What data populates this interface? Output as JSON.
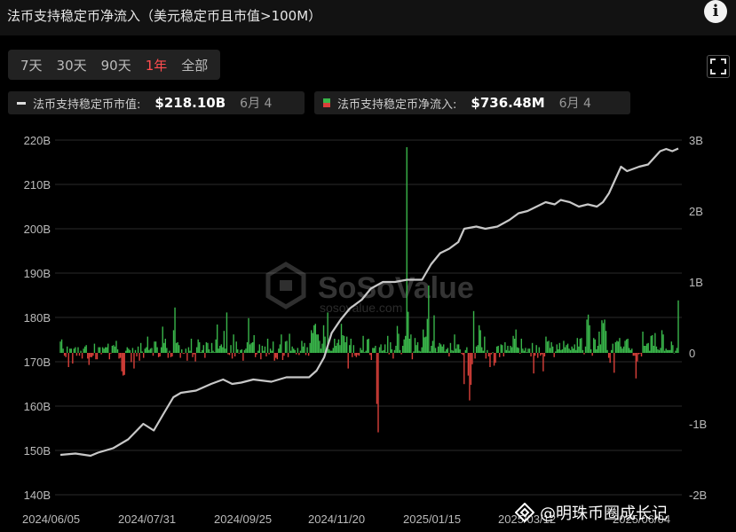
{
  "title": "法币支持稳定币净流入（美元稳定币且市值>100M）",
  "info_icon": "info-icon",
  "range_tabs": [
    {
      "label": "7天",
      "active": false
    },
    {
      "label": "30天",
      "active": false
    },
    {
      "label": "90天",
      "active": false
    },
    {
      "label": "1年",
      "active": true
    },
    {
      "label": "全部",
      "active": false
    }
  ],
  "fullscreen_icon": "fullscreen-icon",
  "legend": {
    "marketcap": {
      "label": "法币支持稳定币市值:",
      "value": "$218.10B",
      "date": "6月 4"
    },
    "inflow": {
      "label": "法币支持稳定币净流入:",
      "value": "$736.48M",
      "date": "6月 4"
    }
  },
  "watermark_text": "@明珠币圈成长记",
  "background_logo": "SoSoValue",
  "background_logo_sub": "sosovalue.com",
  "colors": {
    "positive": "#39b54a",
    "negative": "#d9403a",
    "line": "#c8c8c8",
    "grid": "#2a2a2a",
    "accent": "#ff4d4f"
  },
  "chart_data": {
    "type": "bar+line",
    "x_ticks": [
      "2024/06/05",
      "2024/07/31",
      "2024/09/25",
      "2024/11/20",
      "2025/01/15",
      "2025/03/12",
      "2025/06/04"
    ],
    "left_axis": {
      "ticks": [
        "220B",
        "210B",
        "200B",
        "190B",
        "180B",
        "170B",
        "160B",
        "150B",
        "140B"
      ],
      "ylim": [
        140,
        220
      ],
      "unit": "B"
    },
    "right_axis": {
      "ticks": [
        "3B",
        "2B",
        "1B",
        "0",
        "-1B",
        "-2B"
      ],
      "ylim": [
        -2,
        3
      ],
      "unit": "B"
    },
    "grid": true,
    "series": [
      {
        "name": "法币支持稳定币市值",
        "axis": "left",
        "type": "line",
        "anchors": [
          [
            0,
            149.0
          ],
          [
            10,
            149.3
          ],
          [
            20,
            148.8
          ],
          [
            25,
            149.5
          ],
          [
            35,
            150.5
          ],
          [
            45,
            152.5
          ],
          [
            55,
            156.0
          ],
          [
            62,
            154.5
          ],
          [
            68,
            158.0
          ],
          [
            75,
            162.0
          ],
          [
            80,
            163.0
          ],
          [
            90,
            163.5
          ],
          [
            100,
            165.0
          ],
          [
            108,
            166.0
          ],
          [
            114,
            165.0
          ],
          [
            120,
            165.3
          ],
          [
            128,
            166.0
          ],
          [
            140,
            165.5
          ],
          [
            150,
            166.5
          ],
          [
            165,
            166.5
          ],
          [
            170,
            168.0
          ],
          [
            175,
            171.0
          ],
          [
            180,
            176.5
          ],
          [
            186,
            179.5
          ],
          [
            192,
            182.0
          ],
          [
            200,
            184.0
          ],
          [
            206,
            186.5
          ],
          [
            214,
            188.0
          ],
          [
            222,
            188.0
          ],
          [
            230,
            188.5
          ],
          [
            240,
            188.5
          ],
          [
            246,
            192.0
          ],
          [
            252,
            194.5
          ],
          [
            258,
            195.5
          ],
          [
            264,
            197.0
          ],
          [
            268,
            200.0
          ],
          [
            276,
            200.5
          ],
          [
            282,
            200.0
          ],
          [
            290,
            200.5
          ],
          [
            298,
            202.0
          ],
          [
            304,
            203.5
          ],
          [
            310,
            204.0
          ],
          [
            316,
            205.0
          ],
          [
            322,
            206.0
          ],
          [
            328,
            205.5
          ],
          [
            332,
            206.5
          ],
          [
            338,
            206.0
          ],
          [
            344,
            205.0
          ],
          [
            350,
            205.5
          ],
          [
            356,
            205.0
          ],
          [
            360,
            206.0
          ],
          [
            364,
            208.0
          ],
          [
            368,
            211.0
          ],
          [
            372,
            214.0
          ],
          [
            376,
            213.0
          ],
          [
            384,
            214.0
          ],
          [
            390,
            214.5
          ],
          [
            394,
            216.0
          ],
          [
            398,
            217.5
          ],
          [
            402,
            218.0
          ],
          [
            406,
            217.5
          ],
          [
            410,
            218.1
          ]
        ]
      },
      {
        "name": "法币支持稳定币净流入",
        "axis": "right",
        "type": "bar",
        "values": [
          0.16,
          0.19,
          0.06,
          -0.04,
          -0.06,
          0.09,
          -0.2,
          0.06,
          0.06,
          -0.15,
          0.06,
          0.08,
          -0.04,
          0.08,
          -0.04,
          0.03,
          -0.08,
          0.06,
          0.09,
          0.11,
          -0.08,
          -0.17,
          -0.06,
          -0.06,
          -0.04,
          0.13,
          -0.09,
          -0.09,
          0.08,
          0.08,
          -0.02,
          0.08,
          0.06,
          0.08,
          0.08,
          0.13,
          -0.09,
          -0.01,
          0.1,
          0.11,
          0.09,
          0.17,
          0.05,
          -0.08,
          -0.07,
          -0.26,
          -0.32,
          -0.31,
          0.03,
          0.08,
          0.06,
          0.04,
          -0.13,
          0.07,
          -0.22,
          0.04,
          -0.05,
          0.09,
          -0.11,
          0.14,
          0.02,
          -0.07,
          0.06,
          0.08,
          0.23,
          0.04,
          0.06,
          0.07,
          -0.04,
          0.16,
          0.16,
          0.08,
          -0.06,
          -0.05,
          0.08,
          0.37,
          0.14,
          0.2,
          0.07,
          -0.07,
          0.03,
          -0.06,
          -0.05,
          0.32,
          0.64,
          0.14,
          0.15,
          0.11,
          -0.07,
          0.05,
          -0.01,
          -0.01,
          0.06,
          -0.11,
          0.08,
          0.03,
          0.2,
          -0.06,
          -0.02,
          -0.12,
          0.08,
          0.19,
          0.15,
          0.01,
          0.04,
          0.11,
          -0.07,
          0.15,
          0.14,
          0.05,
          0.01,
          0.14,
          0.03,
          0.01,
          0.19,
          0.4,
          0.06,
          0.1,
          0.12,
          0.08,
          0.31,
          0.06,
          0.57,
          -0.02,
          -0.03,
          0.11,
          -0.08,
          0.26,
          -0.05,
          0.16,
          0.05,
          -0.01,
          0.04,
          0.05,
          -0.11,
          0.04,
          0.06,
          0.15,
          0.49,
          0.12,
          0.14,
          0.15,
          0.25,
          -0.06,
          -0.02,
          0.03,
          0.12,
          -0.09,
          0.1,
          0.03,
          0.09,
          -0.05,
          0.2,
          -0.02,
          0.06,
          0.03,
          0.16,
          -0.11,
          -0.07,
          -0.09,
          0.06,
          0.12,
          0.26,
          -0.1,
          -0.04,
          0.16,
          0.17,
          -0.06,
          0.27,
          0.03,
          0.09,
          0.06,
          0.04,
          -0.02,
          0.07,
          -0.03,
          0.03,
          0.17,
          0.09,
          0.14,
          -0.03,
          0.08,
          -0.04,
          0.14,
          0.32,
          0.28,
          0.39,
          0.41,
          0.26,
          0.26,
          0.17,
          0.06,
          0.13,
          0.39,
          0.23,
          0.04,
          0.57,
          0.05,
          0.03,
          0.03,
          0.07,
          0.2,
          0.1,
          0.14,
          0.19,
          0.11,
          0.41,
          0.25,
          0.24,
          0.15,
          0.23,
          -0.22,
          0.11,
          0.2,
          -0.06,
          0.11,
          -0.04,
          -0.06,
          -0.03,
          -0.04,
          0.07,
          0.04,
          0.24,
          0.01,
          0.03,
          0.19,
          0.2,
          -0.03,
          -0.1,
          0.07,
          0.07,
          0.1,
          -0.72,
          -1.12,
          0.08,
          0.12,
          0.03,
          0.04,
          0.12,
          0.01,
          0.24,
          -0.02,
          0.15,
          0.05,
          -0.08,
          0.04,
          0.1,
          0.38,
          0.27,
          0.04,
          -0.02,
          0.1,
          0.19,
          0.24,
          2.9,
          0.58,
          0.2,
          0.26,
          -0.09,
          0.02,
          0.21,
          0.11,
          0.15,
          0.03,
          0.02,
          0.08,
          0.33,
          0.22,
          0.23,
          0.48,
          0.95,
          0.02,
          0.1,
          0.17,
          0.53,
          0.07,
          0.01,
          0.09,
          0.14,
          0.12,
          0.09,
          0.12,
          0.02,
          0.05,
          0.07,
          -0.05,
          0.14,
          0.04,
          0.03,
          0.26,
          0.06,
          0.12,
          0.12,
          0.05,
          -0.01,
          -0.03,
          -0.44,
          0.04,
          0.08,
          -0.32,
          -0.67,
          -0.45,
          -0.16,
          0.59,
          -0.08,
          0.09,
          0.11,
          0.39,
          0.32,
          0.08,
          0.03,
          0.23,
          -0.08,
          0.04,
          -0.05,
          -0.2,
          -0.02,
          0.01,
          -0.18,
          -0.14,
          0.09,
          0.1,
          -0.06,
          0.12,
          0.11,
          -0.05,
          0.15,
          0.04,
          0.1,
          0.03,
          0.1,
          0.08,
          0.24,
          0.2,
          0.33,
          0.08,
          0.07,
          -0.01,
          0.2,
          0.06,
          0.03,
          0.07,
          0.01,
          0.06,
          0.06,
          -0.05,
          0.14,
          -0.29,
          -0.04,
          0.11,
          -0.07,
          0.08,
          -0.04,
          -0.02,
          -0.26,
          -0.05,
          0.23,
          0.16,
          0.17,
          0.07,
          0.15,
          0.09,
          -0.06,
          0.02,
          0.12,
          0.05,
          0.14,
          0.04,
          0.05,
          0.17,
          0.08,
          0.11,
          0.13,
          0.06,
          0.04,
          0.09,
          0.06,
          0.12,
          0.04,
          0.21,
          0.09,
          0.2,
          0.21,
          0.04,
          -0.02,
          0.09,
          0.47,
          0.54,
          0.39,
          0.05,
          -0.04,
          0.21,
          0.19,
          0.05,
          0.1,
          0.3,
          0.12,
          0.46,
          0.42,
          0.47,
          0.31,
          0.04,
          -0.07,
          -0.14,
          0.04,
          0.13,
          -0.28,
          0.15,
          0.17,
          0.16,
          0.21,
          0.09,
          0.06,
          0.09,
          0.17,
          0.19,
          0.2,
          0.07,
          0.04,
          0.06,
          -0.04,
          -0.04,
          -0.36,
          -0.12,
          -0.02,
          -0.01,
          -0.05,
          0.3,
          0.1,
          0.1,
          0.13,
          0.14,
          0.03,
          0.24,
          0.25,
          0.1,
          0.28,
          0.09,
          0.05,
          0.04,
          0.07,
          0.32,
          0.26,
          0.03,
          0.06,
          0.04,
          0.04,
          0.04,
          0.16,
          0.11,
          0.0,
          0.03,
          0.07,
          0.74
        ]
      }
    ]
  }
}
